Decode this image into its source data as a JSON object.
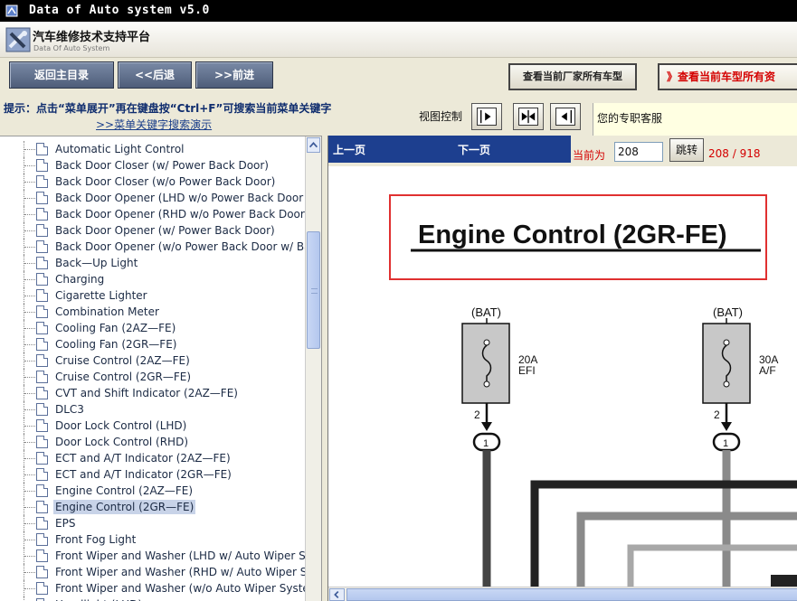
{
  "window": {
    "title": "Data of Auto system v5.0"
  },
  "header": {
    "app_name": "汽车维修技术支持平台",
    "app_sub": "Data Of Auto System"
  },
  "toolbar": {
    "home_label": "返回主目录",
    "back_label": "<<后退",
    "forward_label": ">>前进",
    "manufacturer_models_label": "查看当前厂家所有车型",
    "current_model_label": "》查看当前车型所有资"
  },
  "hint": {
    "text": "提示：点击“菜单展开”再在键盘按“Ctrl+F”可搜索当前菜单关键字",
    "link": ">>菜单关键字搜索演示",
    "view_control_label": "视图控制",
    "support_text": "您的专职客服"
  },
  "tree": {
    "items": [
      {
        "label": "Automatic Light Control"
      },
      {
        "label": "Back Door Closer (w/ Power Back Door)"
      },
      {
        "label": "Back Door Closer (w/o Power Back Door)"
      },
      {
        "label": "Back Door Opener (LHD w/o Power Back Door w"
      },
      {
        "label": "Back Door Opener (RHD w/o Power Back Door w"
      },
      {
        "label": "Back Door Opener (w/ Power Back Door)"
      },
      {
        "label": "Back Door Opener (w/o Power Back Door w/ Ba"
      },
      {
        "label": "Back—Up Light"
      },
      {
        "label": "Charging"
      },
      {
        "label": "Cigarette Lighter"
      },
      {
        "label": "Combination Meter"
      },
      {
        "label": "Cooling Fan (2AZ—FE)"
      },
      {
        "label": "Cooling Fan (2GR—FE)"
      },
      {
        "label": "Cruise Control (2AZ—FE)"
      },
      {
        "label": "Cruise Control (2GR—FE)"
      },
      {
        "label": "CVT and Shift Indicator (2AZ—FE)"
      },
      {
        "label": "DLC3"
      },
      {
        "label": "Door Lock Control (LHD)"
      },
      {
        "label": "Door Lock Control (RHD)"
      },
      {
        "label": "ECT and A/T Indicator (2AZ—FE)"
      },
      {
        "label": "ECT and A/T Indicator (2GR—FE)"
      },
      {
        "label": "Engine Control (2AZ—FE)"
      },
      {
        "label": "Engine Control (2GR—FE)"
      },
      {
        "label": "EPS"
      },
      {
        "label": "Front Fog Light"
      },
      {
        "label": "Front Wiper and Washer (LHD w/ Auto Wiper Sy"
      },
      {
        "label": "Front Wiper and Washer (RHD w/ Auto Wiper Sy"
      },
      {
        "label": "Front Wiper and Washer (w/o Auto Wiper Syster"
      },
      {
        "label": "Headlight (LHD)"
      }
    ],
    "selected_index": 22
  },
  "navigation": {
    "prev_label": "上一页",
    "next_label": "下一页",
    "current_label": "当前为",
    "page_value": "208",
    "jump_label": "跳转",
    "page_count": "208 / 918"
  },
  "diagram": {
    "title": "Engine Control (2GR-FE)",
    "fuse1": {
      "source": "(BAT)",
      "rating": "20A",
      "name": "EFI",
      "pin": "2",
      "connector": "1"
    },
    "fuse2": {
      "source": "(BAT)",
      "rating": "30A",
      "name": "A/F",
      "pin": "2",
      "connector": "1"
    }
  }
}
